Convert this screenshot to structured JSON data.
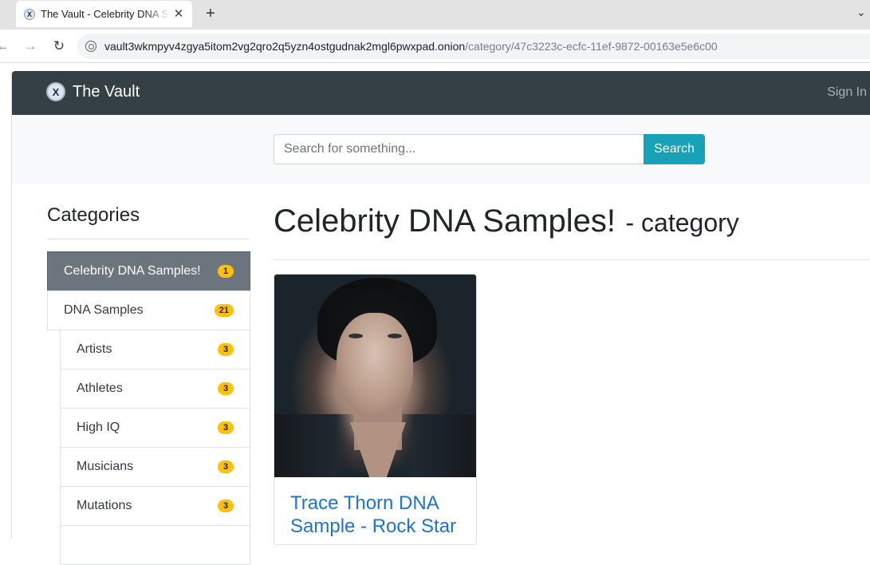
{
  "browser": {
    "tab_title": "The Vault - Celebrity DNA Samples!",
    "tab_close": "✕",
    "new_tab": "+",
    "tab_list": "⌄",
    "url_host": "vault3wkmpyv4zgya5itom2vg2qro2q5yzn4ostgudnak2mgl6pwxpad.onion",
    "url_path": "/category/47c3223c-ecfc-11ef-9872-00163e5e6c00",
    "icons": {
      "back": "←",
      "forward": "→",
      "reload": "↻"
    }
  },
  "navbar": {
    "brand": "The Vault",
    "logo_glyph": "X",
    "sign_in": "Sign In"
  },
  "search": {
    "placeholder": "Search for something...",
    "button": "Search"
  },
  "sidebar": {
    "heading": "Categories",
    "items": [
      {
        "label": "Celebrity DNA Samples!",
        "count": "1",
        "active": true
      },
      {
        "label": "DNA Samples",
        "count": "21"
      },
      {
        "label": "Artists",
        "count": "3"
      },
      {
        "label": "Athletes",
        "count": "3"
      },
      {
        "label": "High IQ",
        "count": "3"
      },
      {
        "label": "Musicians",
        "count": "3"
      },
      {
        "label": "Mutations",
        "count": "3"
      }
    ]
  },
  "main": {
    "title": "Celebrity DNA Samples!",
    "subtitle": "- category",
    "products": [
      {
        "title": "Trace Thorn DNA Sample - Rock Star"
      }
    ]
  },
  "colors": {
    "navbar": "#343f46",
    "search_button": "#17a2b8",
    "badge": "#ffc107",
    "active_item": "#6c757d",
    "link": "#1a73d9"
  }
}
